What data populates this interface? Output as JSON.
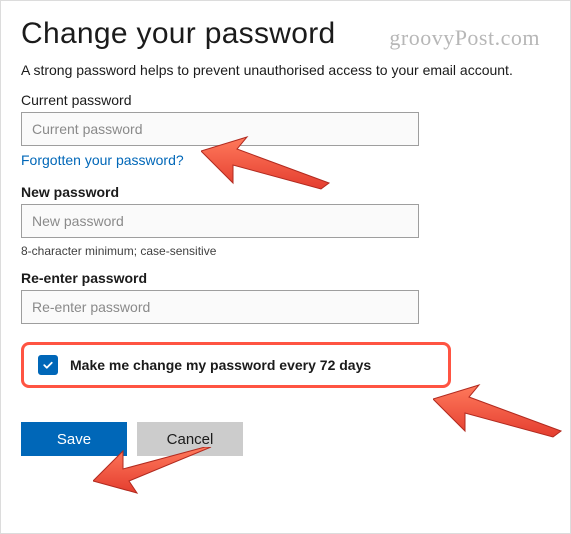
{
  "watermark": "groovyPost.com",
  "title": "Change your password",
  "description": "A strong password helps to prevent unauthorised access to your email account.",
  "current": {
    "label": "Current password",
    "placeholder": "Current password",
    "value": ""
  },
  "forgot_link": "Forgotten your password?",
  "new_password": {
    "label": "New password",
    "placeholder": "New password",
    "value": ""
  },
  "hint": "8-character minimum; case-sensitive",
  "reenter": {
    "label": "Re-enter password",
    "placeholder": "Re-enter password",
    "value": ""
  },
  "reminder": {
    "checked": true,
    "label": "Make me change my password every 72 days"
  },
  "buttons": {
    "save": "Save",
    "cancel": "Cancel"
  }
}
